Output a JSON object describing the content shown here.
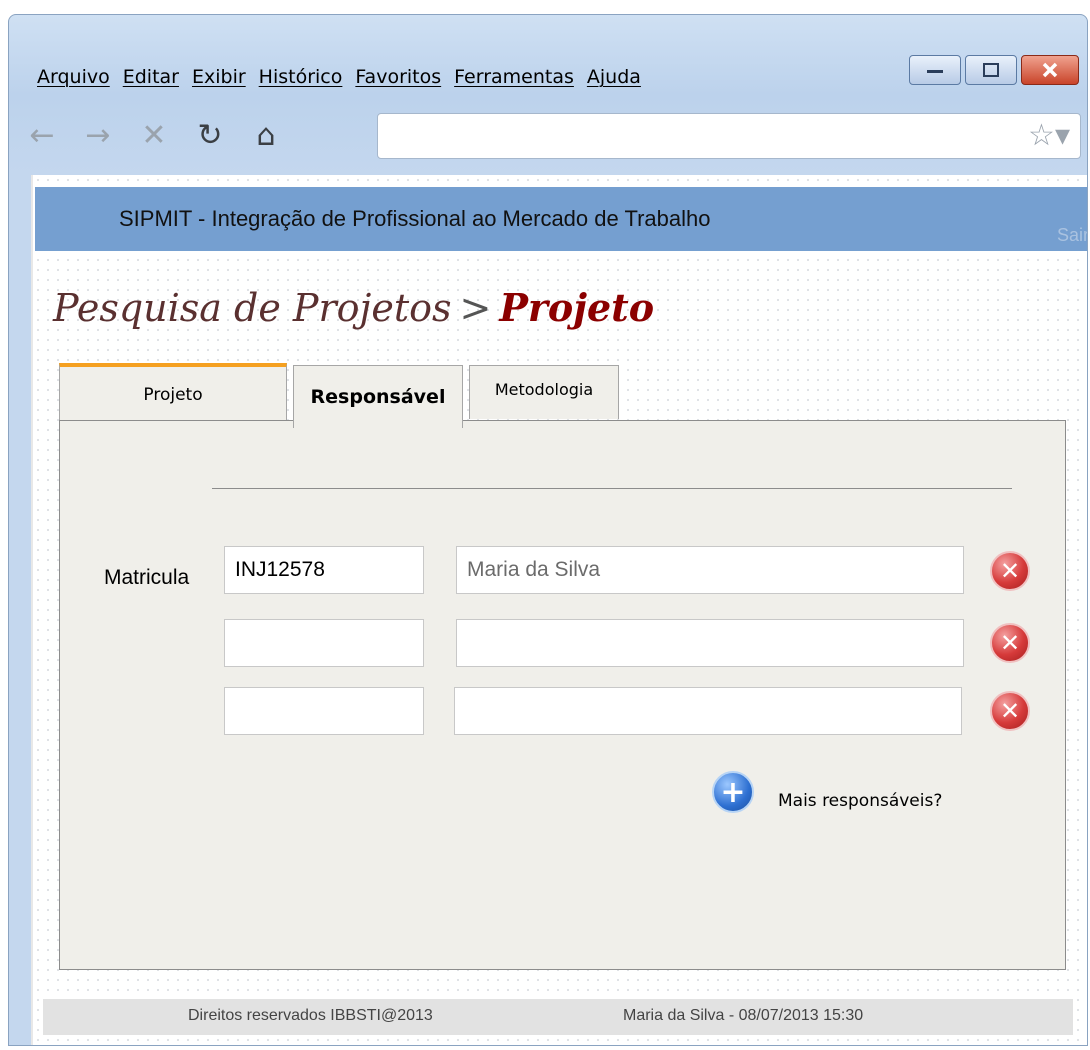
{
  "browser": {
    "menu": [
      "Arquivo",
      "Editar",
      "Exibir",
      "Histórico",
      "Favoritos",
      "Ferramentas",
      "Ajuda"
    ],
    "url": ""
  },
  "app": {
    "header_title": "SIPMIT - Integração de Profissional ao Mercado de Trabalho",
    "logout_label": "Sair"
  },
  "breadcrumb": {
    "parent": "Pesquisa de Projetos",
    "separator": ">",
    "current": "Projeto"
  },
  "tabs": [
    {
      "label": "Projeto"
    },
    {
      "label": "Responsável",
      "active": true
    },
    {
      "label": "Metodologia"
    }
  ],
  "form": {
    "matricula_label": "Matricula",
    "rows": [
      {
        "code": "INJ12578",
        "name": "Maria da Silva"
      },
      {
        "code": "",
        "name": ""
      },
      {
        "code": "",
        "name": ""
      }
    ],
    "add_more_label": "Mais responsáveis?"
  },
  "footer": {
    "copyright": "Direitos reservados IBBSTI@2013",
    "user_info": "Maria da Silva - 08/07/2013 15:30"
  },
  "colors": {
    "header_bg": "#759fd0",
    "tab_accent": "#f5a020",
    "breadcrumb_current": "#8b0000"
  }
}
